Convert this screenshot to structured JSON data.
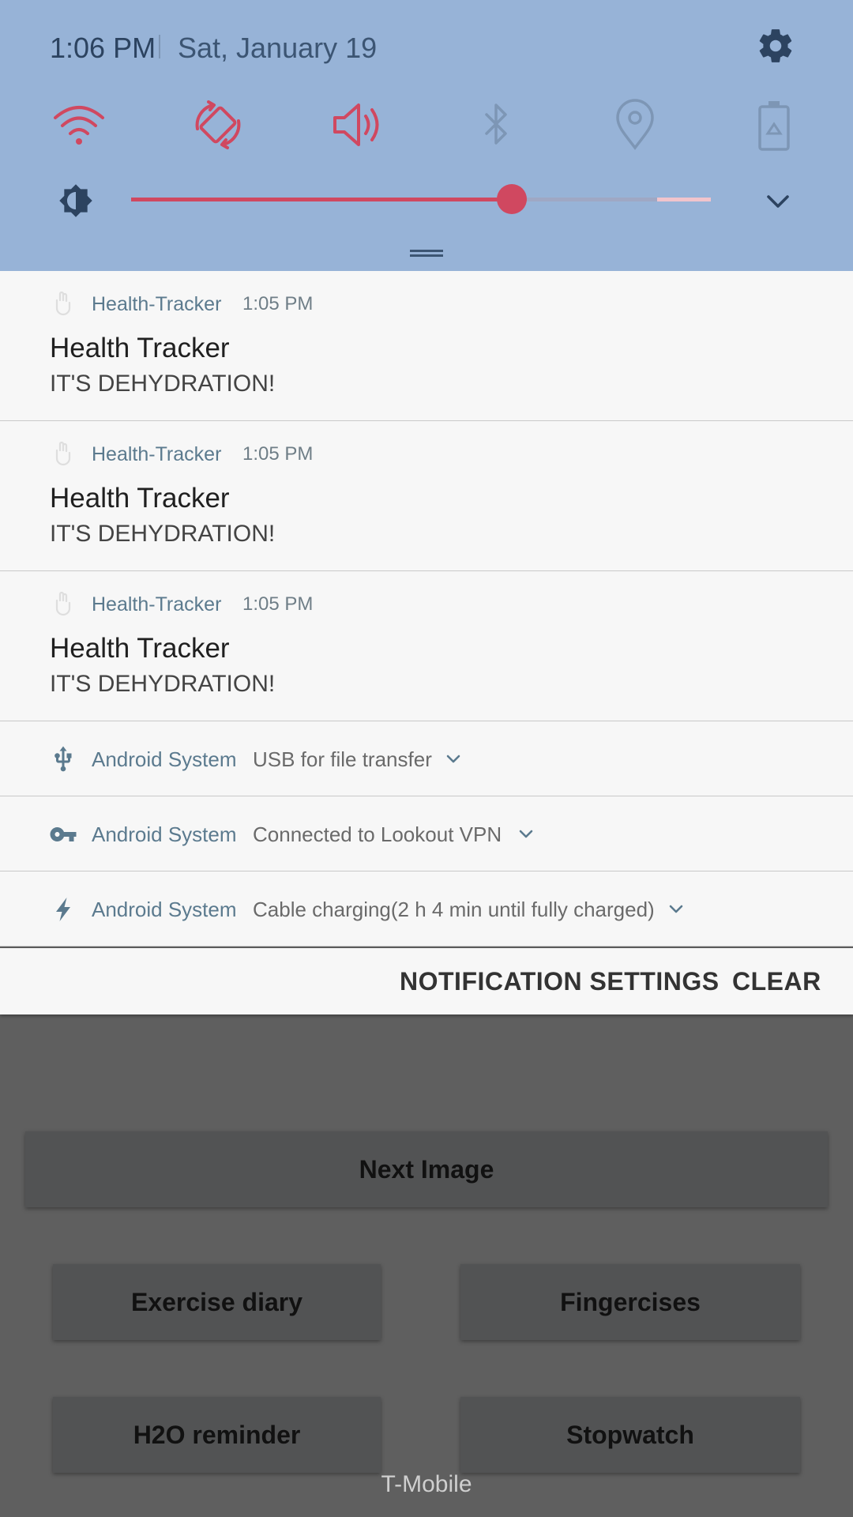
{
  "status": {
    "time": "1:06 PM",
    "date": "Sat, January 19"
  },
  "quick_settings": {
    "tiles": [
      {
        "name": "wifi-icon",
        "active": true
      },
      {
        "name": "auto-rotate-icon",
        "active": true
      },
      {
        "name": "sound-icon",
        "active": true
      },
      {
        "name": "bluetooth-icon",
        "active": false
      },
      {
        "name": "location-icon",
        "active": false
      },
      {
        "name": "power-saving-icon",
        "active": false
      }
    ],
    "brightness_level": 0.66
  },
  "colors": {
    "header_bg": "#97b3d7",
    "accent": "#d04860",
    "inactive_icon": "#7d96b5",
    "panel_bg": "#f7f7f7"
  },
  "notifications": [
    {
      "app": "Health-Tracker",
      "time": "1:05 PM",
      "title": "Health Tracker",
      "text": "IT'S DEHYDRATION!"
    },
    {
      "app": "Health-Tracker",
      "time": "1:05 PM",
      "title": "Health Tracker",
      "text": "IT'S DEHYDRATION!"
    },
    {
      "app": "Health-Tracker",
      "time": "1:05 PM",
      "title": "Health Tracker",
      "text": "IT'S DEHYDRATION!"
    }
  ],
  "system_notifications": [
    {
      "app": "Android System",
      "text": "USB for file transfer",
      "icon": "usb-icon"
    },
    {
      "app": "Android System",
      "text": "Connected to Lookout VPN",
      "icon": "key-icon"
    },
    {
      "app": "Android System",
      "text": "Cable charging(2 h 4 min until fully charged)",
      "icon": "charging-icon"
    }
  ],
  "actions": {
    "settings_label": "NOTIFICATION SETTINGS",
    "clear_label": "CLEAR"
  },
  "app": {
    "next_image": "Next Image",
    "exercise_diary": "Exercise diary",
    "fingercises": "Fingercises",
    "h2o_reminder": "H2O reminder",
    "stopwatch": "Stopwatch"
  },
  "carrier": "T-Mobile"
}
